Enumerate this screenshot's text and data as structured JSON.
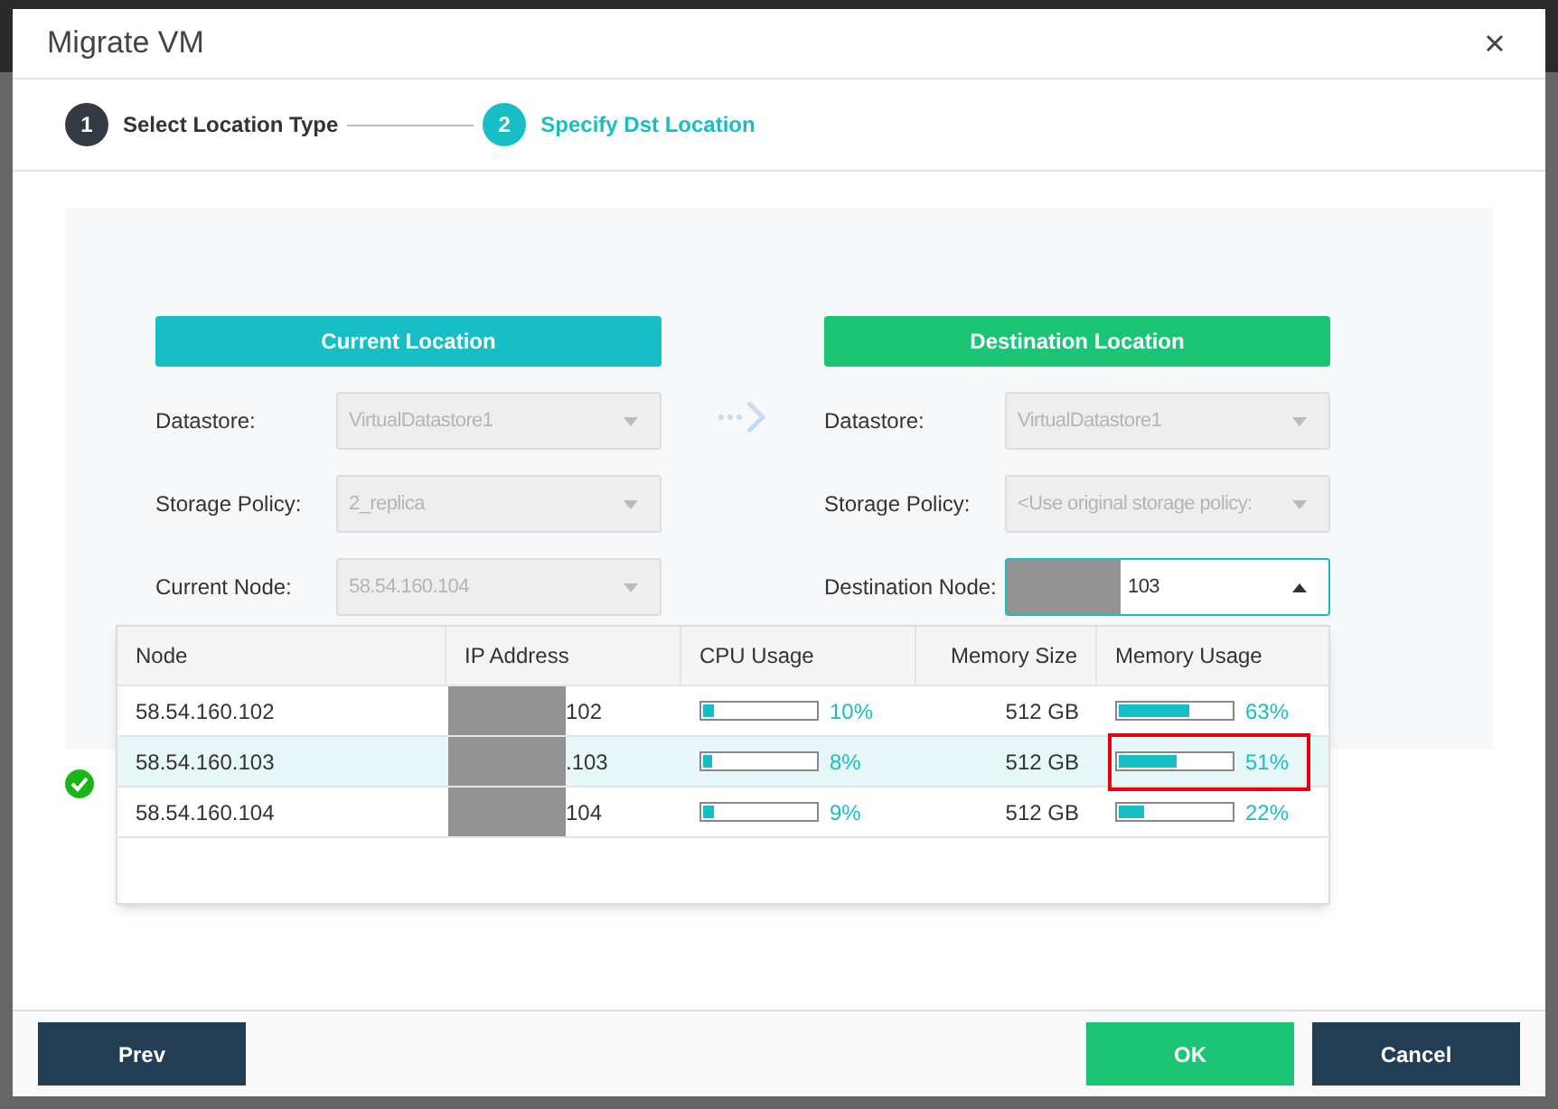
{
  "dialog": {
    "title": "Migrate VM",
    "steps": [
      {
        "number": "1",
        "label": "Select Location Type",
        "selected": false
      },
      {
        "number": "2",
        "label": "Specify Dst Location",
        "selected": true
      }
    ],
    "current": {
      "heading": "Current Location",
      "fields": [
        {
          "label": "Datastore:",
          "value": "VirtualDatastore1",
          "disabled": true
        },
        {
          "label": "Storage Policy:",
          "value": "2_replica",
          "disabled": true
        },
        {
          "label": "Current Node:",
          "value": "58.54.160.104",
          "disabled": true
        }
      ]
    },
    "destination": {
      "heading": "Destination Location",
      "fields": [
        {
          "label": "Datastore:",
          "value": "VirtualDatastore1",
          "disabled": true,
          "redacted": false,
          "expanded": false
        },
        {
          "label": "Storage Policy:",
          "value": "<Use original storage policy:",
          "disabled": true,
          "redacted": false,
          "expanded": false
        },
        {
          "label": "Destination Node:",
          "value": "103",
          "disabled": false,
          "redacted": true,
          "expanded": true
        }
      ]
    },
    "node_table": {
      "columns": [
        "Node",
        "IP Address",
        "CPU Usage",
        "Memory Size",
        "Memory Usage"
      ],
      "rows": [
        {
          "node": "58.54.160.102",
          "ip": "102",
          "cpu": {
            "text": "10%",
            "level": 0.1
          },
          "memory_size": "512 GB",
          "memory": {
            "text": "63%",
            "level": 0.63
          },
          "selected": false,
          "highlighted": false
        },
        {
          "node": "58.54.160.103",
          "ip": ".103",
          "cpu": {
            "text": "8%",
            "level": 0.08
          },
          "memory_size": "512 GB",
          "memory": {
            "text": "51%",
            "level": 0.51
          },
          "selected": true,
          "highlighted": true
        },
        {
          "node": "58.54.160.104",
          "ip": "104",
          "cpu": {
            "text": "9%",
            "level": 0.09
          },
          "memory_size": "512 GB",
          "memory": {
            "text": "22%",
            "level": 0.22
          },
          "selected": false,
          "highlighted": false
        }
      ]
    },
    "buttons": {
      "prev": "Prev",
      "ok": "OK",
      "cancel": "Cancel"
    }
  }
}
